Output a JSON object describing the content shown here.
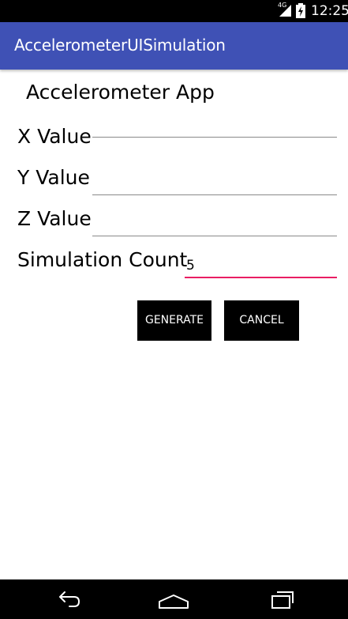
{
  "status_bar": {
    "network_label": "4G",
    "time": "12:25"
  },
  "app_bar": {
    "title": "AccelerometerUISimulation"
  },
  "main": {
    "heading": "Accelerometer App",
    "fields": [
      {
        "label": "X Value",
        "value": ""
      },
      {
        "label": "Y Value",
        "value": ""
      },
      {
        "label": "Z Value",
        "value": ""
      },
      {
        "label": "Simulation Count",
        "value": "5"
      }
    ],
    "buttons": {
      "generate": "GENERATE",
      "cancel": "CANCEL"
    }
  },
  "colors": {
    "app_bar": "#3f51b5",
    "focus_underline": "#e91e63"
  },
  "nav_bar": {
    "icons": [
      "back-icon",
      "home-icon",
      "recents-icon"
    ]
  }
}
